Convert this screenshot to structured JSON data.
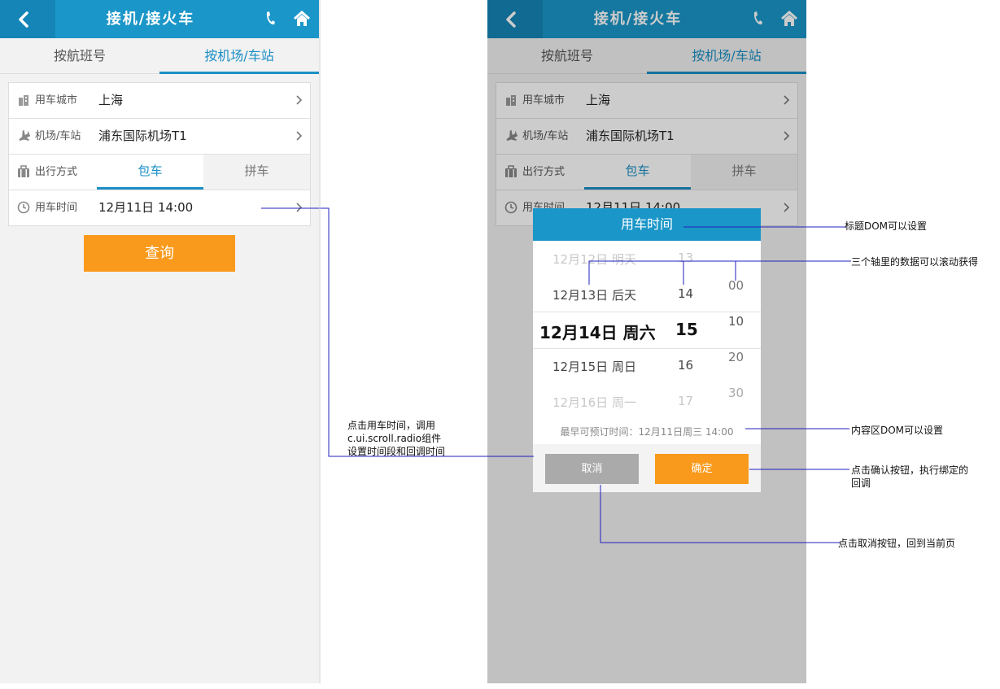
{
  "header": {
    "title": "接机/接火车",
    "back_icon": "back-arrow-icon",
    "phone_icon": "phone-icon",
    "home_icon": "home-icon"
  },
  "tabs": [
    {
      "label": "按航班号",
      "active": false
    },
    {
      "label": "按机场/车站",
      "active": true
    }
  ],
  "form": {
    "city": {
      "label": "用车城市",
      "value": "上海"
    },
    "airport": {
      "label": "机场/车站",
      "value": "浦东国际机场T1"
    },
    "mode": {
      "label": "出行方式",
      "options": [
        "包车",
        "拼车"
      ],
      "selected": "包车"
    },
    "time": {
      "label": "用车时间",
      "value": "12月11日 14:00"
    }
  },
  "query_label": "查询",
  "modal": {
    "title": "用车时间",
    "date_wheel": [
      "12月12日 明天",
      "12月13日 后天",
      "12月14日 周六",
      "12月15日 周日",
      "12月16日 周一"
    ],
    "hour_wheel": [
      "13",
      "14",
      "15",
      "16",
      "17"
    ],
    "minute_wheel": [
      "00",
      "10",
      "20",
      "30"
    ],
    "note": "最早可预订时间：12月11日周三 14:00",
    "cancel_label": "取消",
    "ok_label": "确定"
  },
  "annotations": {
    "left_note_lines": [
      "点击用车时间，调用",
      "c.ui.scroll.radio组件",
      "设置时间段和回调时间"
    ],
    "title_note": "标题DOM可以设置",
    "axis_note": "三个轴里的数据可以滚动获得",
    "content_note": "内容区DOM可以设置",
    "ok_note_lines": [
      "点击确认按钮，执行绑定的",
      "回调"
    ],
    "cancel_note": "点击取消按钮，回到当前页"
  },
  "colors": {
    "primary": "#1b96c8",
    "accent": "#fa9a1c",
    "line": "#2020c0"
  }
}
